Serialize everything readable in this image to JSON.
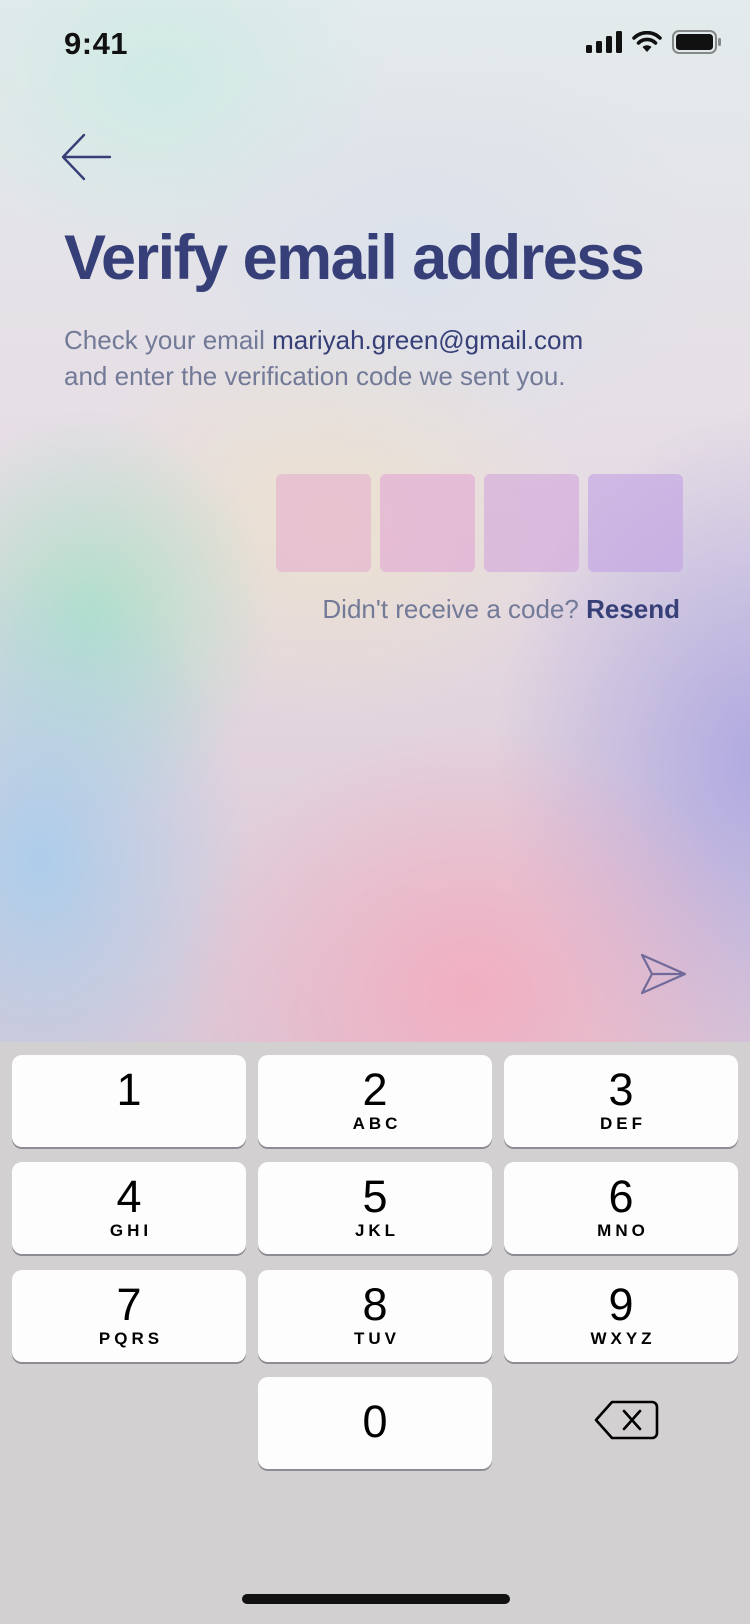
{
  "status_bar": {
    "time": "9:41",
    "icons": [
      "signal-icon",
      "wifi-icon",
      "battery-icon"
    ]
  },
  "header": {
    "back_icon": "arrow-left-icon",
    "title": "Verify email address",
    "subtitle_prefix": "Check your email ",
    "email": "mariyah.green@gmail.com",
    "subtitle_suffix": "and enter the verification code we sent you."
  },
  "code_input": {
    "length": 4,
    "values": [
      "",
      "",
      "",
      ""
    ]
  },
  "resend": {
    "prompt": "Didn't receive a code?",
    "link_label": "Resend"
  },
  "send_icon": "send-icon",
  "keyboard": {
    "keys": [
      {
        "digit": "1",
        "letters": ""
      },
      {
        "digit": "2",
        "letters": "ABC"
      },
      {
        "digit": "3",
        "letters": "DEF"
      },
      {
        "digit": "4",
        "letters": "GHI"
      },
      {
        "digit": "5",
        "letters": "JKL"
      },
      {
        "digit": "6",
        "letters": "MNO"
      },
      {
        "digit": "7",
        "letters": "PQRS"
      },
      {
        "digit": "8",
        "letters": "TUV"
      },
      {
        "digit": "9",
        "letters": "WXYZ"
      },
      {
        "digit": "0",
        "letters": ""
      }
    ],
    "delete_icon": "backspace-icon"
  },
  "colors": {
    "primary_text": "#363f77",
    "secondary_text": "#727a98",
    "keyboard_bg": "#d3d0d2",
    "key_bg": "#fdfdfe"
  }
}
